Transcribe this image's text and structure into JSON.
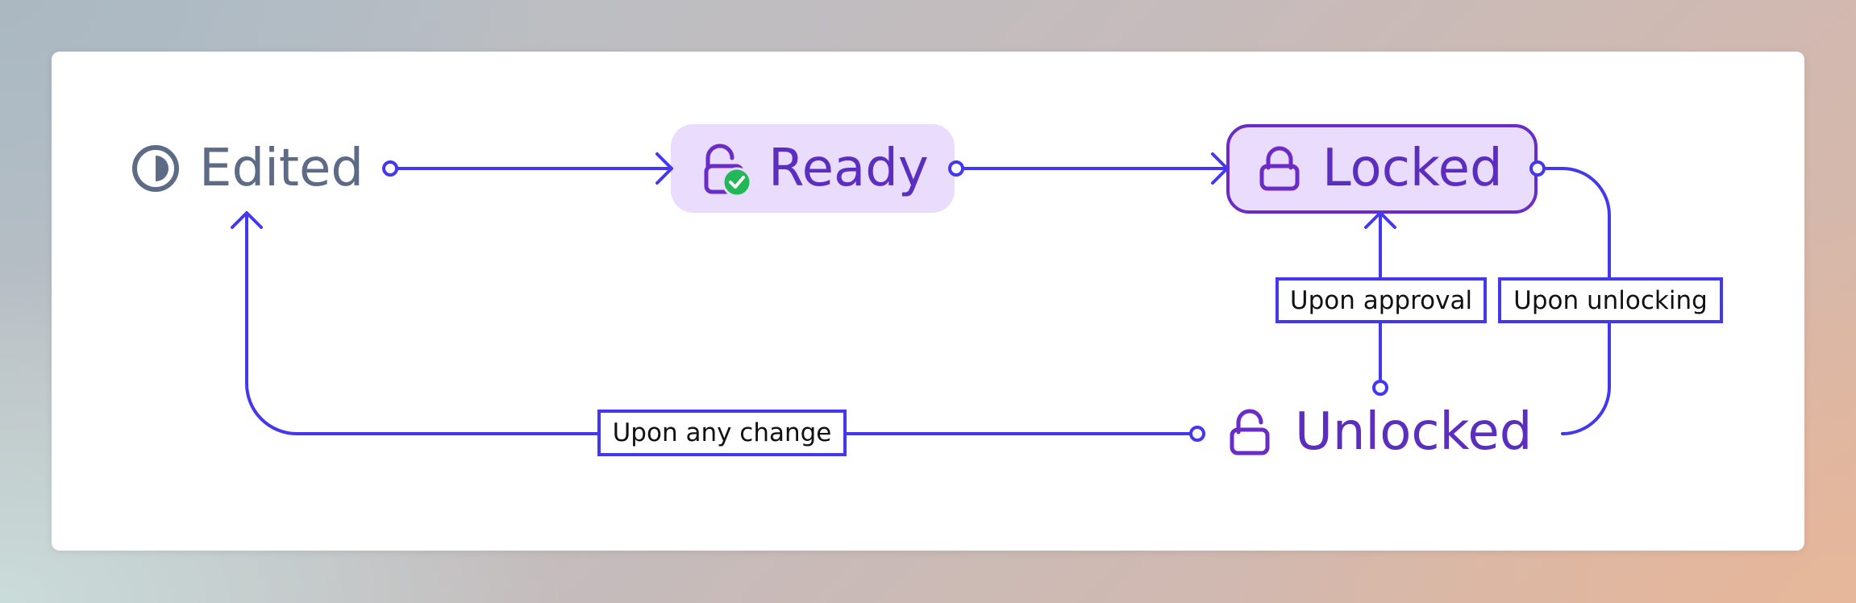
{
  "nodes": {
    "edited": {
      "label": "Edited",
      "icon": "half-circle-icon"
    },
    "ready": {
      "label": "Ready",
      "icon": "unlocked-check-icon"
    },
    "locked": {
      "label": "Locked",
      "icon": "lock-icon"
    },
    "unlocked": {
      "label": "Unlocked",
      "icon": "unlock-icon"
    }
  },
  "edges": {
    "approval": "Upon approval",
    "unlocking": "Upon unlocking",
    "any_change": "Upon any change"
  },
  "colors": {
    "edge": "#4338f0",
    "state_text": "#5b2ebf",
    "edited_text": "#5e6b86",
    "node_fill": "#e9dcfc",
    "check_badge": "#22b857"
  }
}
